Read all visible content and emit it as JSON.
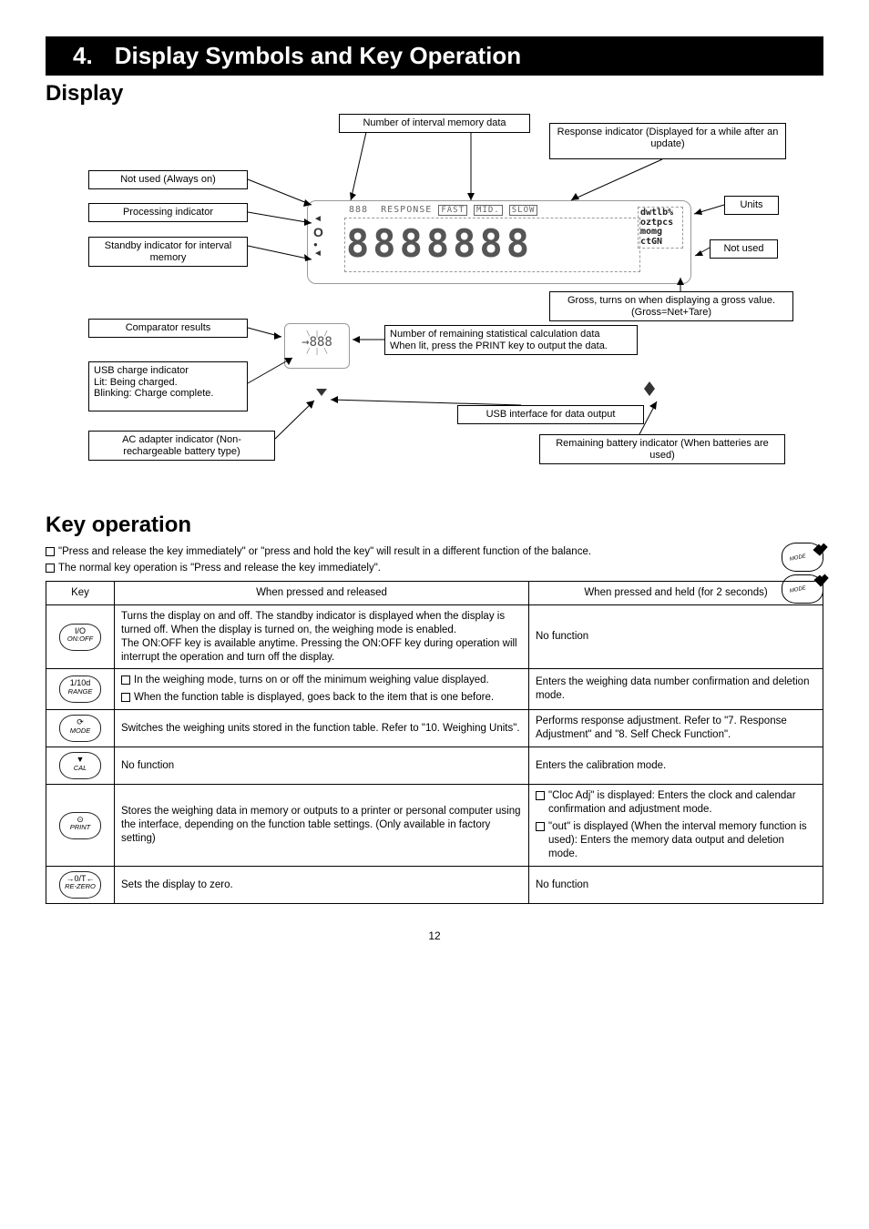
{
  "title": {
    "num": "4.",
    "text": "Display Symbols and Key Operation"
  },
  "sections": {
    "display": "Display",
    "key_op": "Key operation"
  },
  "labels": {
    "interval_memory": "Number of interval memory data",
    "response_indicator": "Response indicator (Displayed for a while after an update)",
    "stable_zero": "Not used (Always on)",
    "smart_range": "Processing indicator",
    "standby": "Standby indicator for interval memory",
    "comparator": "Comparator results",
    "units": "Units",
    "net": "Not used",
    "gross": "Gross, turns on when displaying a gross value. (Gross=Net+Tare)",
    "usb_left": "USB charge indicator\nLit: Being charged.\nBlinking: Charge complete.",
    "remaining_battery": "Number of remaining statistical calculation data",
    "remaining_battery2": "When lit, press the PRINT key to output the data.",
    "ac_left": "AC adapter indicator (Non-rechargeable battery type)",
    "usb_right": "USB interface for data output",
    "ac_right": "Remaining battery indicator (When batteries are used)",
    "lcd_top_segments": "888",
    "lcd_response": "RESPONSE",
    "lcd_fast": "FAST",
    "lcd_mid": "MID.",
    "lcd_slow": "SLOW",
    "units_block": "dwtlb%\noztpcs\nmomg\nctGN",
    "lcd_left_stable": "O",
    "lcd_left_processing": "◄",
    "lcd_small": "888"
  },
  "key_notes": {
    "a": "\"Press and release the key immediately\" or \"press and hold the key\" will result in a different function of the balance.",
    "b": "The normal key operation is \"Press and release the key immediately\"."
  },
  "table": {
    "head": {
      "key": "Key",
      "press": "When pressed and released",
      "hold": "When pressed and held (for 2 seconds)"
    },
    "rows": [
      {
        "btn": {
          "top": "I/O",
          "bottom": "ON:OFF"
        },
        "press": "Turns the display on and off. The standby indicator is displayed when the display is turned off. When the display is turned on, the weighing mode is enabled.\nThe ON:OFF key is available anytime. Pressing the ON:OFF key during operation will interrupt the operation and turn off the display.",
        "hold": "No function"
      },
      {
        "btn": {
          "top": "1/10d",
          "bottom": "RANGE"
        },
        "press_items": [
          "In the weighing mode, turns on or off the minimum weighing value displayed.",
          "When the function table is displayed, goes back to the item that is one before."
        ],
        "hold": "Enters the weighing data number confirmation and deletion mode."
      },
      {
        "btn": {
          "top": "",
          "bottom": "MODE",
          "icon": "cycle"
        },
        "press": "Switches the weighing units stored in the function table. Refer to \"10. Weighing Units\".",
        "hold": "Performs response adjustment. Refer to \"7. Response Adjustment\" and \"8. Self Check Function\"."
      },
      {
        "btn": {
          "top": "▼",
          "bottom": "CAL"
        },
        "press": "No function",
        "hold": "Enters the calibration mode."
      },
      {
        "btn": {
          "top": "",
          "bottom": "PRINT",
          "icon": "dot"
        },
        "press": "Stores the weighing data in memory or outputs to a printer or personal computer using the interface, depending on the function table settings. (Only available in factory setting)",
        "hold_items": [
          "\"Cloc Adj\" is displayed: Enters the clock and calendar confirmation and adjustment mode.",
          "\"out\" is displayed (When the interval memory function is used): Enters the memory data output and deletion mode."
        ]
      },
      {
        "btn": {
          "top": "→0/T←",
          "bottom": "RE-ZERO"
        },
        "press": "Sets the display to zero.",
        "hold": "No function"
      }
    ]
  },
  "footer": "12"
}
